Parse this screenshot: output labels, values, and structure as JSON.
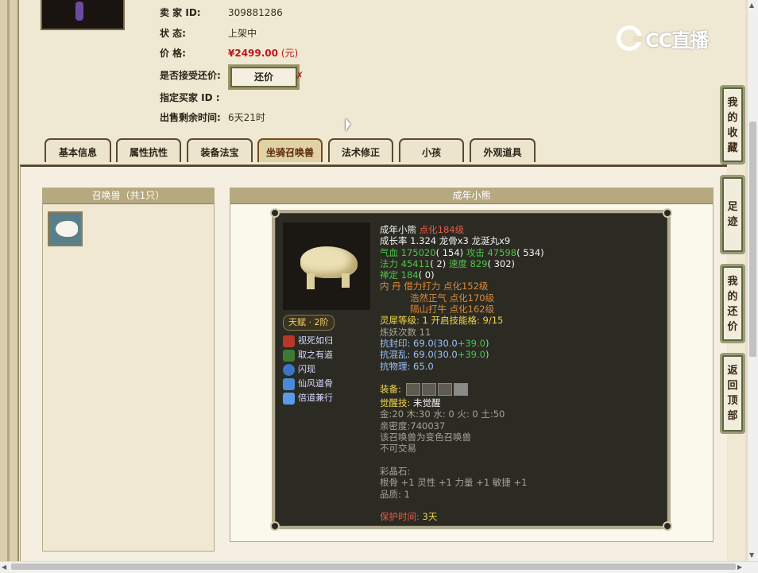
{
  "seller_info": {
    "seller_label": "卖 家  ID:",
    "seller_id": "309881286",
    "status_label": "状    态:",
    "status_value": "上架中",
    "price_label": "价    格:",
    "price_value": "¥2499.00",
    "price_unit": "(元)",
    "counter_label": "是否接受还价:",
    "counter_button": "还价",
    "counter_mark": "✗",
    "buyer_label": "指定买家 ID :",
    "remaining_label": "出售剩余时间:",
    "remaining_value": "6天21时"
  },
  "logo": {
    "text": "CC直播"
  },
  "tabs": [
    {
      "label": "基本信息"
    },
    {
      "label": "属性抗性"
    },
    {
      "label": "装备法宝"
    },
    {
      "label": "坐骑召唤兽",
      "active": true
    },
    {
      "label": "法术修正"
    },
    {
      "label": "小孩"
    },
    {
      "label": "外观道具"
    }
  ],
  "left_panel": {
    "title": "召唤兽（共1只）"
  },
  "right_panel": {
    "title": "成年小熊"
  },
  "pet": {
    "name": "成年小熊",
    "refine": "点化184级",
    "growth": "成长率 1.324 龙骨x3 龙涎丸x9",
    "hp_label": "气血",
    "hp_value": "175020",
    "hp_extra": "( 154)",
    "atk_label": "攻击",
    "atk_value": "47598",
    "atk_extra": "( 534)",
    "mp_label": "法力",
    "mp_value": "45411",
    "mp_extra": "( 2)",
    "spd_label": "速度",
    "spd_value": "829",
    "spd_extra": "( 302)",
    "zen_label": "禅定",
    "zen_value": "184",
    "zen_extra": "( 0)",
    "neidan_label": "内    丹",
    "neidan_1": "借力打力 点化152级",
    "neidan_2": "浩然正气 点化170级",
    "neidan_3": "隔山打牛 点化162级",
    "spirit_line": "灵犀等级:  1 开启技能格:  9/15",
    "refine_count": "炼妖次数 11",
    "resist_seal_label": "抗封印:",
    "resist_seal_a": " 69.0(30.0",
    "resist_seal_b": "+39.0",
    "resist_seal_c": ")",
    "resist_chaos_label": "抗混乱:",
    "resist_chaos_a": " 69.0(30.0",
    "resist_chaos_b": "+39.0",
    "resist_chaos_c": ")",
    "resist_phys": "抗物理: 65.0",
    "equip_label": "装备:",
    "awaken_label": "觉醒技:",
    "awaken_value": "未觉醒",
    "elements": "金:20 木:30 水: 0 火: 0 土:50",
    "intimacy": "亲密度:740037",
    "note1": "该召唤兽为变色召唤兽",
    "note2": "不可交易",
    "gem_title": "彩晶石:",
    "gem_line": "根骨 +1 灵性 +1 力量 +1 敏捷 +1",
    "quality": "品质: 1",
    "protect_label": "保护时间:",
    "protect_value": "3天",
    "talent_badge": "天赋 · 2阶",
    "skills": [
      {
        "name": "视死如归",
        "color": "#b8372a"
      },
      {
        "name": "取之有道",
        "color": "#3e7a34"
      },
      {
        "name": "闪现",
        "color": "#3a76c8"
      },
      {
        "name": "仙风道骨",
        "color": "#4a8ad8"
      },
      {
        "name": "倍道兼行",
        "color": "#5a9ae8"
      }
    ]
  },
  "side_buttons": [
    {
      "label": [
        "我",
        "的",
        "收",
        "藏"
      ]
    },
    {
      "label": [
        "足",
        "迹"
      ]
    },
    {
      "label": [
        "我",
        "的",
        "还",
        "价"
      ]
    },
    {
      "label": [
        "返",
        "回",
        "顶",
        "部"
      ]
    }
  ],
  "colors": {
    "price": "#c0141a",
    "tab_border": "#5a4a30",
    "card_bg": "#2b2b23"
  }
}
